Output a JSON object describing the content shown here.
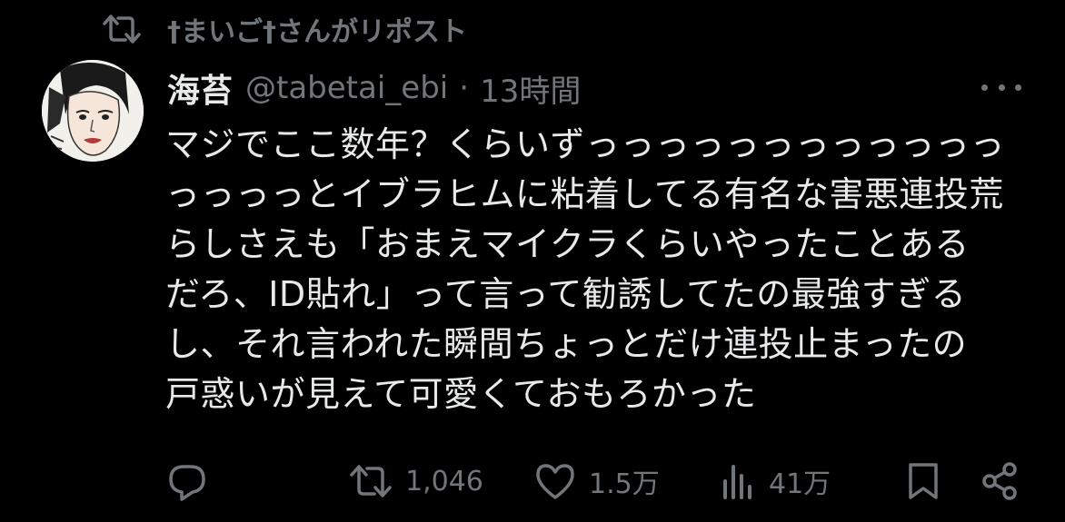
{
  "repost_header": {
    "icon": "repost-icon",
    "text": "†まいご†さんがリポスト"
  },
  "author": {
    "display_name": "海苔",
    "handle": "@tabetai_ebi",
    "separator": "·",
    "time": "13時間",
    "avatar": "avatar-illustration"
  },
  "more_icon": "more-icon",
  "tweet": {
    "lines": [
      "マジでここ数年？くらいずっっっっっっっっっっっっ",
      "っっっっとイブラヒムに粘着してる有名な害悪連投荒",
      "らしさえも「おまえマイクラくらいやったことある",
      "だろ、ID貼れ」って言って勧誘してたの最強すぎる",
      "し、それ言われた瞬間ちょっとだけ連投止まったの",
      "戸惑いが見えて可愛くておもろかった"
    ]
  },
  "actions": {
    "reply": {
      "icon": "reply-icon",
      "count": ""
    },
    "repost": {
      "icon": "repost-icon",
      "count": "1,046"
    },
    "like": {
      "icon": "heart-icon",
      "count": "1.5万"
    },
    "views": {
      "icon": "views-icon",
      "count": "41万"
    },
    "bookmark": {
      "icon": "bookmark-icon"
    },
    "share": {
      "icon": "share-icon"
    }
  },
  "colors": {
    "background": "#000000",
    "text_primary": "#e7e9ea",
    "text_secondary": "#71767b"
  }
}
